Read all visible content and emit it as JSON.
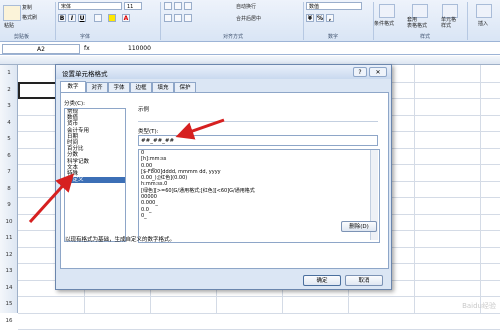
{
  "ribbon": {
    "paste_label": "粘贴",
    "copy_label": "复制",
    "format_painter_label": "格式刷",
    "font_name": "宋体",
    "font_size": "11",
    "bold": "B",
    "italic": "I",
    "underline": "U",
    "wrap_text_label": "自动换行",
    "merge_center_label": "合并后居中",
    "number_format": "数值",
    "conditional_format_label": "条件格式",
    "table_format_label": "套用\n表格格式",
    "cell_style_label": "单元格\n样式",
    "insert_label": "插入",
    "groups": {
      "clipboard": "剪贴板",
      "font": "字体",
      "alignment": "对齐方式",
      "number": "数字",
      "styles": "样式"
    }
  },
  "formula_bar": {
    "name_box": "A2",
    "fx": "fx",
    "value": "110000"
  },
  "grid": {
    "row_numbers": [
      "1",
      "2",
      "3",
      "4",
      "5",
      "6",
      "7",
      "8",
      "9",
      "10",
      "11",
      "12",
      "13",
      "14",
      "15",
      "16"
    ]
  },
  "dialog": {
    "title": "设置单元格格式",
    "help": "?",
    "close": "✕",
    "tabs": [
      "数字",
      "对齐",
      "字体",
      "边框",
      "填充",
      "保护"
    ],
    "category_label": "分类(C):",
    "categories": [
      "常规",
      "数值",
      "货币",
      "会计专用",
      "日期",
      "时间",
      "百分比",
      "分数",
      "科学记数",
      "文本",
      "特殊",
      "自定义"
    ],
    "selected_category_index": 11,
    "sample_label": "示例",
    "type_label": "类型(T):",
    "type_value": "##_##_##",
    "formats": [
      "0",
      "[h]:mm:ss",
      "0.00_",
      "[$-F800]dddd, mmmm dd, yyyy",
      "0.00_);[红色](0.00)",
      "h:mm:ss.0",
      "[绿色][>=60]G/通用格式;[红色][<60]G/通用格式",
      "00000",
      "0.000_",
      "0.0_",
      "0_"
    ],
    "delete_button": "删除(D)",
    "hint": "以现有格式为基础，生成自定义的数字格式。",
    "ok_button": "确定",
    "cancel_button": "取消"
  },
  "watermark": "Baidu经验",
  "colors": {
    "arrow": "#d62020",
    "selection": "#3c6fb6"
  }
}
